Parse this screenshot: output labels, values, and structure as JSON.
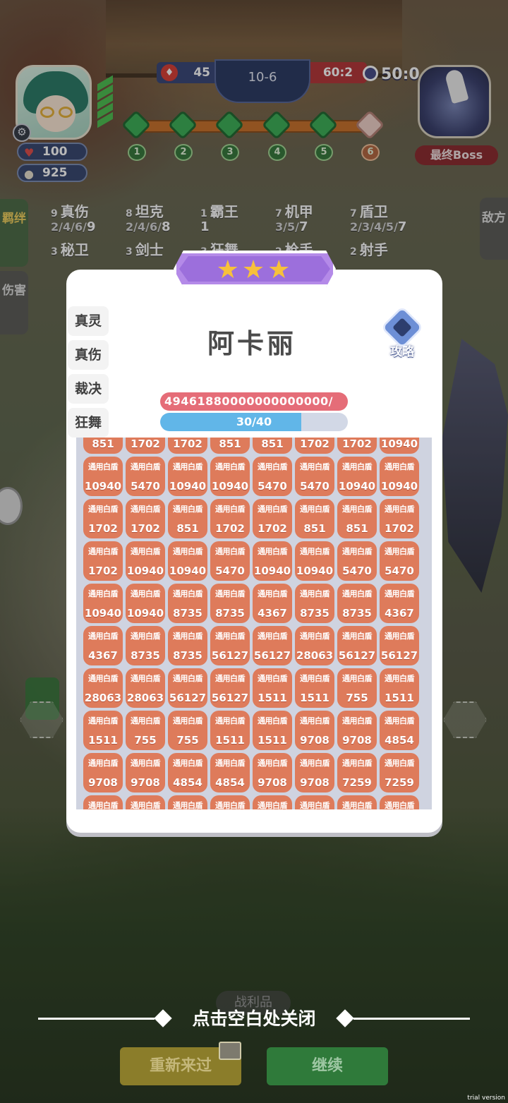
{
  "hud": {
    "hp_value": "100",
    "coin_value": "925",
    "enemy_count": "45",
    "round": "10-6",
    "score_ratio": "60:2",
    "timer": "50:0",
    "boss_label": "最终Boss",
    "waves": [
      "1",
      "2",
      "3",
      "4",
      "5",
      "6"
    ]
  },
  "side_tabs": {
    "bond": "羁绊",
    "damage": "伤害",
    "enemy": "敌方"
  },
  "bonds_row1": [
    {
      "n": "9",
      "name": "真伤",
      "tiers": "2/4/6/",
      "cur": "9"
    },
    {
      "n": "8",
      "name": "坦克",
      "tiers": "2/4/6/",
      "cur": "8"
    },
    {
      "n": "1",
      "name": "霸王",
      "tiers": "",
      "cur": "1"
    },
    {
      "n": "7",
      "name": "机甲",
      "tiers": "3/5/",
      "cur": "7"
    },
    {
      "n": "7",
      "name": "盾卫",
      "tiers": "2/3/4/5/",
      "cur": "7"
    }
  ],
  "bonds_row2": [
    {
      "n": "3",
      "name": "秘卫"
    },
    {
      "n": "3",
      "name": "剑士"
    },
    {
      "n": "3",
      "name": "狂舞"
    },
    {
      "n": "2",
      "name": "枪手"
    },
    {
      "n": "2",
      "name": "射手"
    }
  ],
  "popup": {
    "stars": "★★★",
    "hero_name": "阿卡丽",
    "guide_label": "攻略",
    "side_labels": [
      "真灵",
      "真伤",
      "裁决",
      "狂舞"
    ],
    "hp_text": "49461880000000000000/",
    "exp_text": "30/40",
    "exp_current": 30,
    "exp_max": 40,
    "cell_title": "通用白盾",
    "cells": [
      "851",
      "1702",
      "1702",
      "851",
      "851",
      "1702",
      "1702",
      "10940",
      "10940",
      "5470",
      "10940",
      "10940",
      "5470",
      "5470",
      "10940",
      "10940",
      "1702",
      "1702",
      "851",
      "1702",
      "1702",
      "851",
      "851",
      "1702",
      "1702",
      "10940",
      "10940",
      "5470",
      "10940",
      "10940",
      "5470",
      "5470",
      "10940",
      "10940",
      "8735",
      "8735",
      "4367",
      "8735",
      "8735",
      "4367",
      "4367",
      "8735",
      "8735",
      "56127",
      "56127",
      "28063",
      "56127",
      "56127",
      "28063",
      "28063",
      "56127",
      "56127",
      "1511",
      "1511",
      "755",
      "1511",
      "1511",
      "755",
      "755",
      "1511",
      "1511",
      "9708",
      "9708",
      "4854",
      "9708",
      "9708",
      "4854",
      "4854",
      "9708",
      "9708",
      "7259",
      "7259",
      "",
      "",
      "",
      "",
      "",
      "",
      "",
      ""
    ]
  },
  "bottom": {
    "close_hint": "点击空白处关闭",
    "behind_label": "战利品",
    "retry": "重新来过",
    "continue": "继续",
    "watermark": "trial version"
  }
}
